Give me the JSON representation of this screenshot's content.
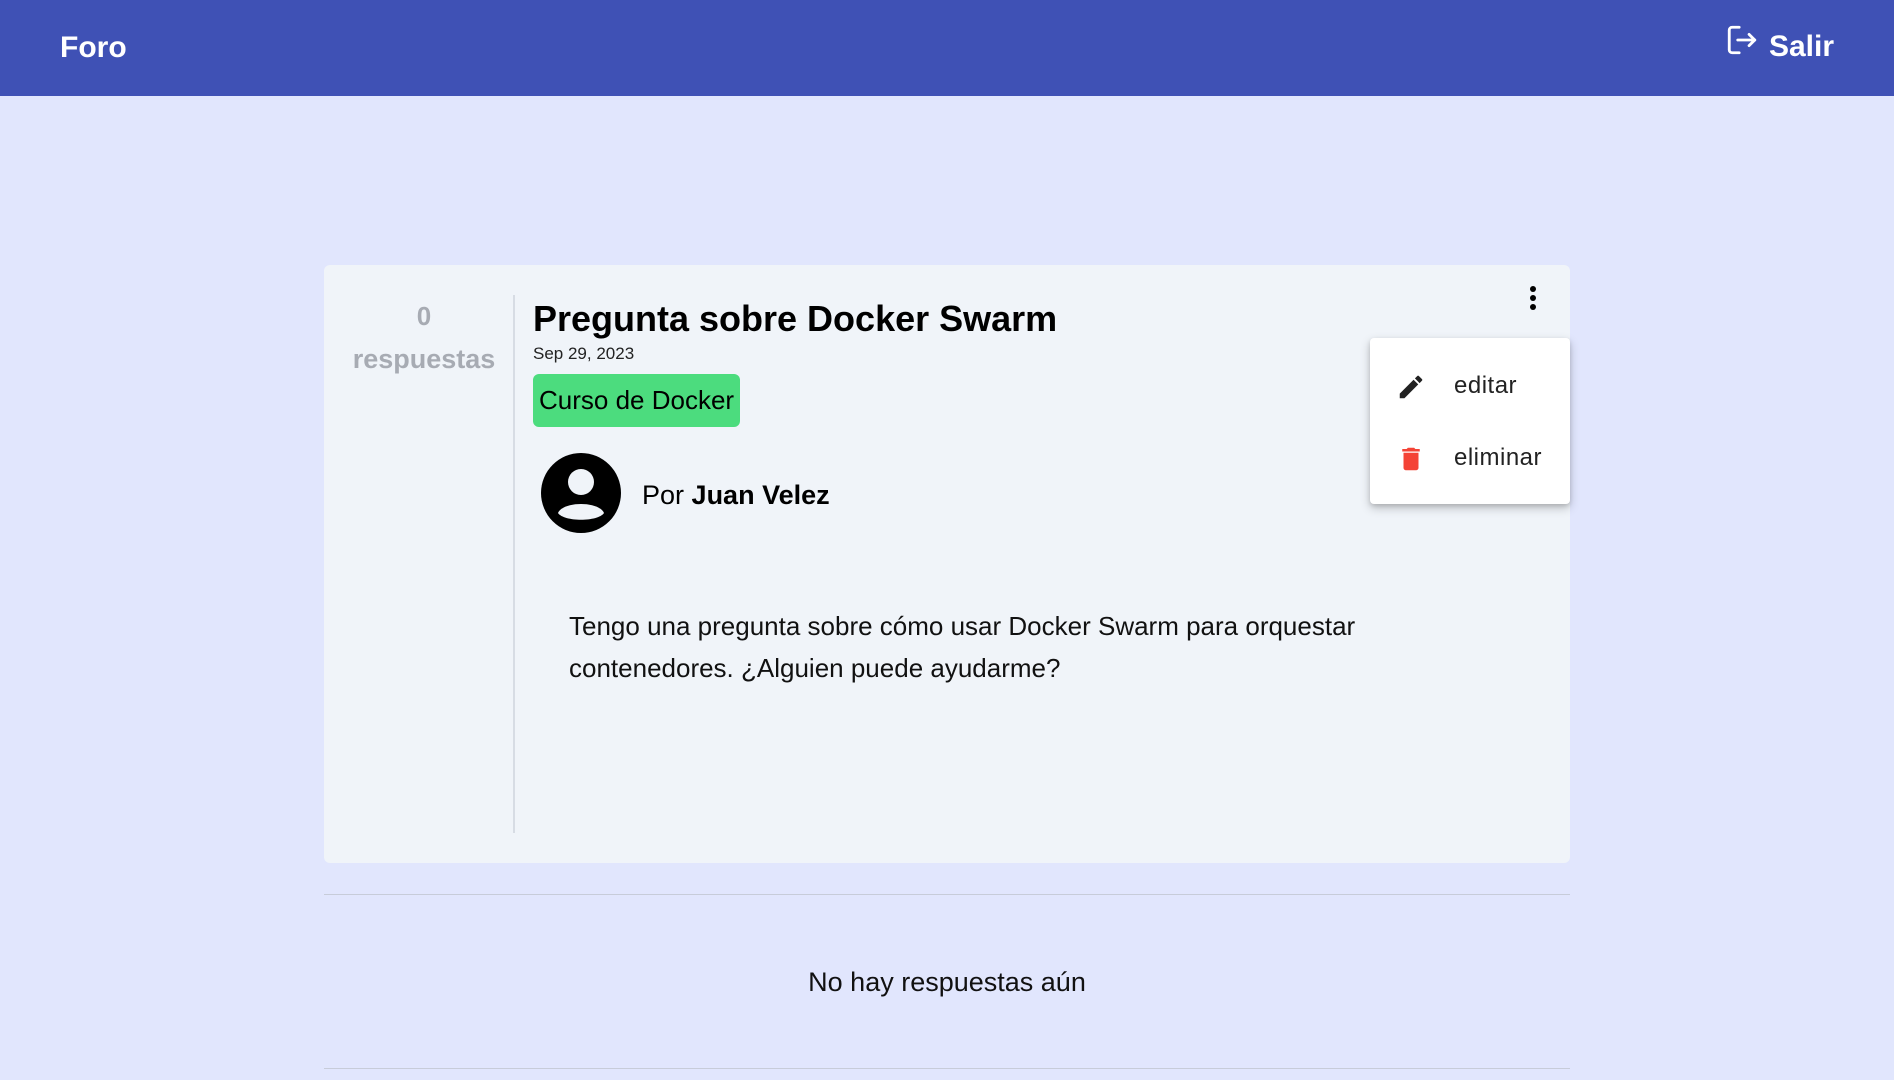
{
  "app": {
    "title": "Foro",
    "logout_label": "Salir",
    "logout_icon": "logout-icon"
  },
  "post": {
    "answers_count": "0",
    "answers_label": "respuestas",
    "title": "Pregunta sobre Docker Swarm",
    "date": "Sep 29, 2023",
    "tag": "Curso de Docker",
    "tag_color": "#4cdc7e",
    "author_prefix": "Por",
    "author_name": "Juan Velez",
    "body": "Tengo una pregunta sobre cómo usar Docker Swarm para orquestar contenedores. ¿Alguien puede ayudarme?"
  },
  "menu": {
    "items": [
      {
        "label": "editar",
        "icon": "pencil-icon"
      },
      {
        "label": "eliminar",
        "icon": "trash-icon",
        "icon_color": "#f44336"
      }
    ]
  },
  "replies": {
    "empty_message": "No hay respuestas aún"
  },
  "colors": {
    "topbar": "#3f51b5",
    "background": "#e1e6fd",
    "card": "#f0f4f9"
  }
}
